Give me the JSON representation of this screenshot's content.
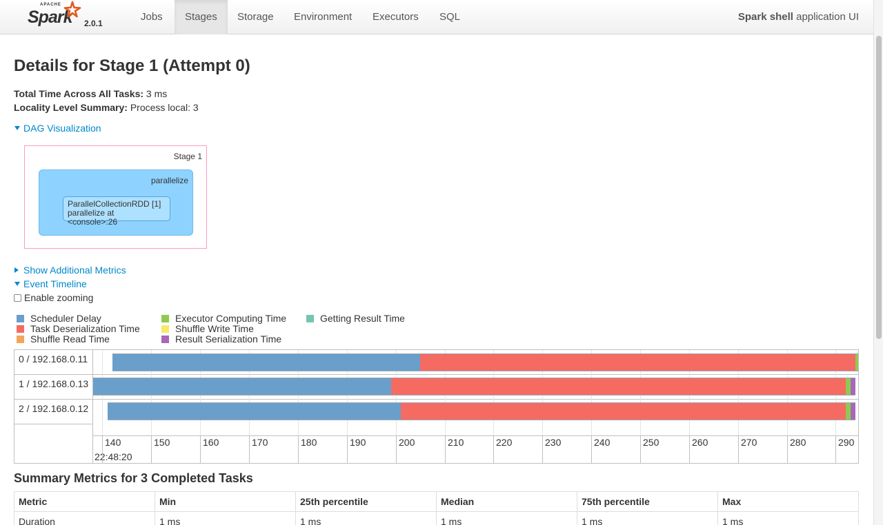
{
  "brand": {
    "apache": "APACHE",
    "name": "Spark",
    "version": "2.0.1"
  },
  "nav": {
    "tabs": [
      {
        "label": "Jobs",
        "active": false
      },
      {
        "label": "Stages",
        "active": true
      },
      {
        "label": "Storage",
        "active": false
      },
      {
        "label": "Environment",
        "active": false
      },
      {
        "label": "Executors",
        "active": false
      },
      {
        "label": "SQL",
        "active": false
      }
    ],
    "app_name": "Spark shell",
    "app_suffix": " application UI"
  },
  "page": {
    "title": "Details for Stage 1 (Attempt 0)",
    "total_time_label": "Total Time Across All Tasks:",
    "total_time_value": " 3 ms",
    "locality_label": "Locality Level Summary:",
    "locality_value": " Process local: 3"
  },
  "dag": {
    "toggle_label": "DAG Visualization",
    "stage_label": "Stage 1",
    "cluster_label": "parallelize",
    "node_line1": "ParallelCollectionRDD [1]",
    "node_line2": "parallelize at <console>:26"
  },
  "links": {
    "additional_metrics": "Show Additional Metrics",
    "event_timeline": "Event Timeline",
    "enable_zooming": "Enable zooming"
  },
  "legend": [
    {
      "label": "Scheduler Delay",
      "color": "#6a9fcb"
    },
    {
      "label": "Task Deserialization Time",
      "color": "#f56b62"
    },
    {
      "label": "Shuffle Read Time",
      "color": "#f3a55a"
    },
    {
      "label": "Executor Computing Time",
      "color": "#8fca50"
    },
    {
      "label": "Shuffle Write Time",
      "color": "#f7e96b"
    },
    {
      "label": "Result Serialization Time",
      "color": "#a868b7"
    },
    {
      "label": "Getting Result Time",
      "color": "#76c4b3"
    }
  ],
  "timeline": {
    "axis_ticks": [
      "140",
      "150",
      "160",
      "170",
      "180",
      "190",
      "200",
      "210",
      "220",
      "230",
      "240",
      "250",
      "260",
      "270",
      "280",
      "290"
    ],
    "axis_date": "22:48:20",
    "x_range_ms": [
      138.1,
      294.6
    ],
    "rows": [
      {
        "label": "0 / 192.168.0.11",
        "segments": [
          {
            "color": "#6a9fcb",
            "start": 142.0,
            "end": 205.0
          },
          {
            "color": "#f56b62",
            "start": 205.0,
            "end": 294.0
          },
          {
            "color": "#8fca50",
            "start": 294.0,
            "end": 294.6
          }
        ]
      },
      {
        "label": "1 / 192.168.0.13",
        "segments": [
          {
            "color": "#6a9fcb",
            "start": 138.1,
            "end": 199.0
          },
          {
            "color": "#f56b62",
            "start": 199.0,
            "end": 292.0
          },
          {
            "color": "#8fca50",
            "start": 292.0,
            "end": 293.0
          },
          {
            "color": "#a868b7",
            "start": 293.0,
            "end": 294.0
          }
        ]
      },
      {
        "label": "2 / 192.168.0.12",
        "segments": [
          {
            "color": "#6a9fcb",
            "start": 141.0,
            "end": 201.0
          },
          {
            "color": "#f56b62",
            "start": 201.0,
            "end": 292.0
          },
          {
            "color": "#8fca50",
            "start": 292.0,
            "end": 293.0
          },
          {
            "color": "#a868b7",
            "start": 293.0,
            "end": 294.0
          }
        ]
      }
    ]
  },
  "summary": {
    "title": "Summary Metrics for 3 Completed Tasks",
    "headers": [
      "Metric",
      "Min",
      "25th percentile",
      "Median",
      "75th percentile",
      "Max"
    ],
    "rows": [
      [
        "Duration",
        "1 ms",
        "1 ms",
        "1 ms",
        "1 ms",
        "1 ms"
      ]
    ]
  }
}
